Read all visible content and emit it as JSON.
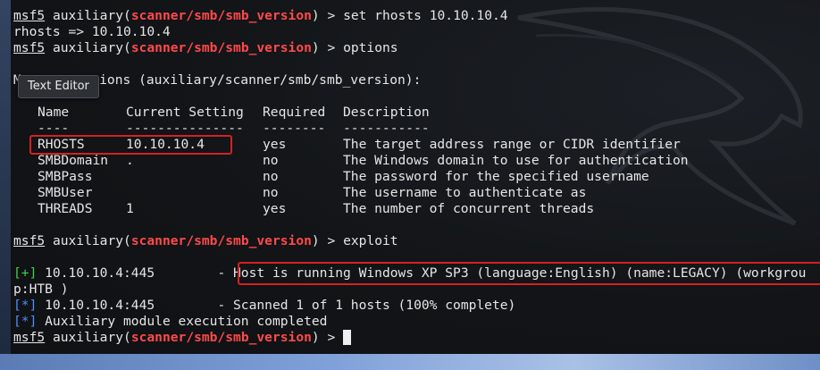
{
  "prompt": {
    "user": "msf5",
    "mid": " auxiliary(",
    "module": "scanner/smb/smb_version",
    "end": ") > "
  },
  "commands": {
    "set": "set rhosts 10.10.10.4",
    "set_result": "rhosts => 10.10.10.4",
    "options": "options",
    "exploit": "exploit"
  },
  "module_options_title": "Module options (auxiliary/scanner/smb/smb_version):",
  "module_options_title_visible_start": "Mo",
  "module_options_title_visible_end": "ptions (auxiliary/scanner/smb/smb_version):",
  "table": {
    "headers": [
      "Name",
      "Current Setting",
      "Required",
      "Description"
    ],
    "separators": [
      "----",
      "---------------",
      "--------",
      "-----------"
    ],
    "rows": [
      {
        "name": "RHOSTS",
        "setting": "10.10.10.4",
        "required": "yes",
        "description": "The target address range or CIDR identifier"
      },
      {
        "name": "SMBDomain",
        "setting": ".",
        "required": "no",
        "description": "The Windows domain to use for authentication"
      },
      {
        "name": "SMBPass",
        "setting": "",
        "required": "no",
        "description": "The password for the specified username"
      },
      {
        "name": "SMBUser",
        "setting": "",
        "required": "no",
        "description": "The username to authenticate as"
      },
      {
        "name": "THREADS",
        "setting": "1",
        "required": "yes",
        "description": "The number of concurrent threads"
      }
    ]
  },
  "results": {
    "host_tag": "[+]",
    "host_addr": " 10.10.10.4:445        - ",
    "host_msg": "Host is running Windows XP SP3 (language:English) (name:LEGACY) (workgrou",
    "host_wrap": "p:HTB )",
    "scan_tag": "[*]",
    "scan_line": " 10.10.10.4:445        - Scanned 1 of 1 hosts (100% complete)",
    "done_tag": "[*]",
    "done_line": " Auxiliary module execution completed"
  },
  "tooltip": "Text Editor",
  "colors": {
    "background": "#121417",
    "module_red": "#ff4a4a",
    "info_blue": "#4f8fff",
    "success_green": "#3fd24d",
    "highlight_box": "#d32222"
  }
}
